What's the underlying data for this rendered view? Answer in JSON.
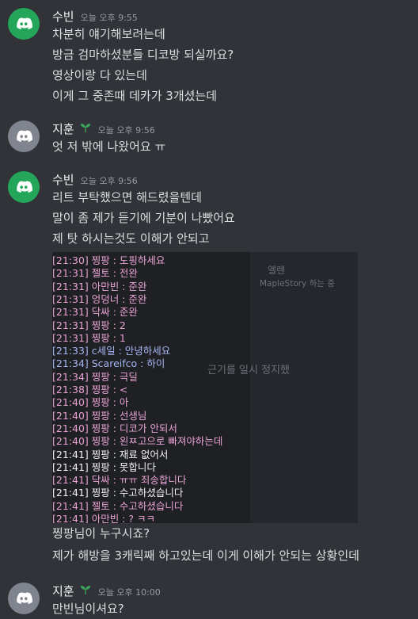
{
  "colors": {
    "background": "#313338",
    "discord_green": "#23a55a",
    "discord_gray": "#80848e",
    "log_pink": "#e8a2d3",
    "log_blue": "#a6b6f4",
    "log_white": "#f2f2f2",
    "badge_green": "#3ba55c"
  },
  "messages": [
    {
      "user": "수빈",
      "time": "오늘 오후 9:55",
      "avatar_icon": "discord-logo-icon",
      "lines": [
        "차분히 얘기해보려는데",
        "방금 검마하셨분들 디코방 되실까요?",
        "영상이랑 다 있는데",
        "이게 그 중존때 데카가 3개셨는데"
      ]
    },
    {
      "user": "지훈",
      "time": "오늘 오후 9:56",
      "avatar_icon": "discord-logo-icon",
      "badge_icon": "sprout-icon",
      "lines": [
        "엇 저 밖에 나왔어요 ㅠ"
      ]
    },
    {
      "user": "수빈",
      "time": "오늘 오후 9:56",
      "avatar_icon": "discord-logo-icon",
      "lines": [
        "리트 부탁했으면 해드렸을텐데",
        "말이 좀 제가 듣기에 기분이 나빴어요",
        "제 탓 하시는것도 이해가 안되고"
      ],
      "after_lines": [
        "찡팡님이 누구시죠?",
        "제가 해방을 3캐릭째 하고있는데 이게 이해가 안되는 상황인데"
      ]
    },
    {
      "user": "지훈",
      "time": "오늘 오후 10:00",
      "avatar_icon": "discord-logo-icon",
      "badge_icon": "sprout-icon",
      "lines": [
        "만빈님이셔요?"
      ]
    }
  ],
  "chat_log": {
    "ghost_texts": [
      "엘렌",
      "MapleStory 하는 중",
      "근기를 일시 정지했"
    ],
    "rows": [
      {
        "text": "[21:30] 찡팡 : 도핑하세요",
        "color": "#e8a2d3"
      },
      {
        "text": "[21:31] 젤토 : 전완",
        "color": "#e8a2d3"
      },
      {
        "text": "[21:31] 아만빈 : 준완",
        "color": "#e8a2d3"
      },
      {
        "text": "[21:31] 엉덩너 : 준완",
        "color": "#e8a2d3"
      },
      {
        "text": "[21:31] 닥싸 : 준완",
        "color": "#e8a2d3"
      },
      {
        "text": "[21:31] 찡팡 : 2",
        "color": "#e8a2d3"
      },
      {
        "text": "[21:31] 찡팡 : 1",
        "color": "#e8a2d3"
      },
      {
        "text": "[21:33] c세일 : 안녕하세요",
        "color": "#a6b6f4"
      },
      {
        "text": "[21:34] Scareifco : 하이",
        "color": "#a6b6f4"
      },
      {
        "text": "[21:34] 찡팡 : 극딜",
        "color": "#e8a2d3"
      },
      {
        "text": "[21:38] 찡팡 : <",
        "color": "#e8a2d3"
      },
      {
        "text": "[21:40] 찡팡 : 아",
        "color": "#e8a2d3"
      },
      {
        "text": "[21:40] 찡팡 : 선생님",
        "color": "#e8a2d3"
      },
      {
        "text": "[21:40] 찡팡 : 디코가 안되서",
        "color": "#e8a2d3"
      },
      {
        "text": "[21:40] 찡팡 : 왼ㅉ고으로 빠져야하는데",
        "color": "#e8a2d3"
      },
      {
        "text": "[21:41] 찡팡 : 재료 없어서",
        "color": "#f2f2f2"
      },
      {
        "text": "[21:41] 찡팡 : 못합니다",
        "color": "#f2f2f2"
      },
      {
        "text": "[21:41] 닥싸 : ㅠㅠ 죄송합니다",
        "color": "#e8a2d3"
      },
      {
        "text": "[21:41] 찡팡 : 수고하셨습니다",
        "color": "#f2f2f2"
      },
      {
        "text": "[21:41] 젤토 : 수고하셨습니다",
        "color": "#e8a2d3"
      },
      {
        "text": "[21:41] 아만빈 : ? ㅋㅋ",
        "color": "#e8a2d3"
      }
    ]
  }
}
